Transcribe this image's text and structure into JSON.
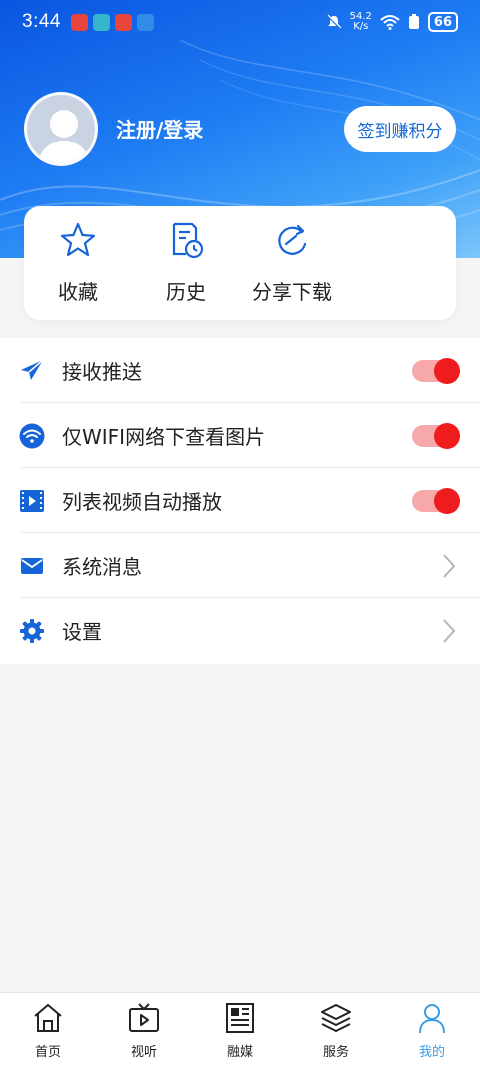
{
  "status_bar": {
    "time": "3:44",
    "net_speed_value": "54.2",
    "net_speed_unit": "K/s",
    "battery": "66"
  },
  "profile": {
    "login_label": "注册/登录",
    "checkin_label": "签到赚积分"
  },
  "quick_actions": [
    {
      "label": "收藏",
      "icon": "star-icon"
    },
    {
      "label": "历史",
      "icon": "history-icon"
    },
    {
      "label": "分享下载",
      "icon": "share-icon"
    }
  ],
  "settings": [
    {
      "label": "接收推送",
      "icon": "send-icon",
      "control": "toggle",
      "on": true
    },
    {
      "label": "仅WIFI网络下查看图片",
      "icon": "wifi-icon",
      "control": "toggle",
      "on": true
    },
    {
      "label": "列表视频自动播放",
      "icon": "video-icon",
      "control": "toggle",
      "on": true
    },
    {
      "label": "系统消息",
      "icon": "mail-icon",
      "control": "chevron"
    },
    {
      "label": "设置",
      "icon": "gear-icon",
      "control": "chevron"
    }
  ],
  "tabs": [
    {
      "label": "首页",
      "icon": "home-icon",
      "active": false
    },
    {
      "label": "视听",
      "icon": "tv-icon",
      "active": false
    },
    {
      "label": "融媒",
      "icon": "newspaper-icon",
      "active": false
    },
    {
      "label": "服务",
      "icon": "layers-icon",
      "active": false
    },
    {
      "label": "我的",
      "icon": "user-icon",
      "active": true
    }
  ],
  "colors": {
    "accent_blue": "#1565d8",
    "toggle_on": "#ee1c1c",
    "tab_active": "#3a9de6"
  }
}
